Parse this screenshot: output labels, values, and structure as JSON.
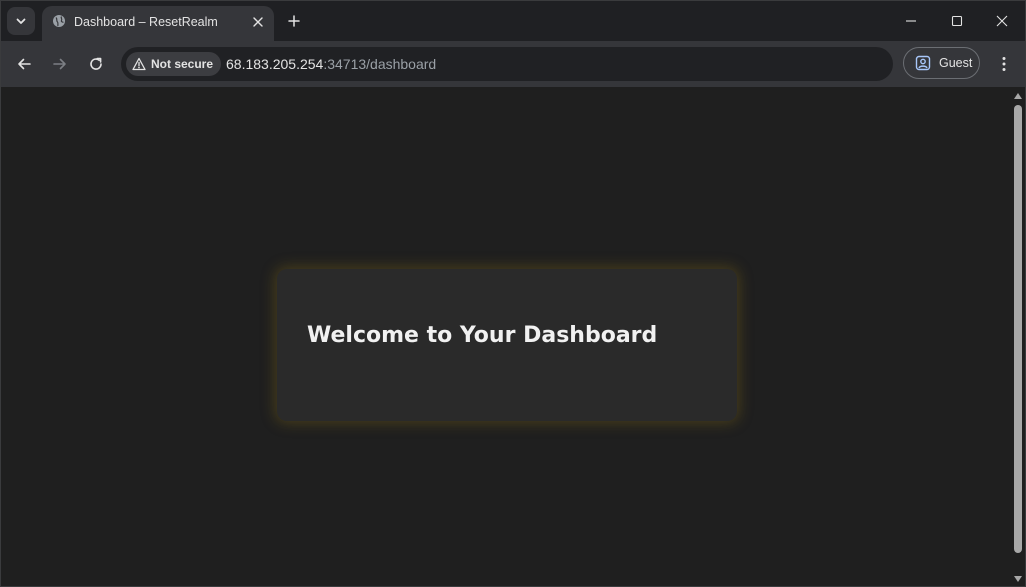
{
  "browser": {
    "tab": {
      "title": "Dashboard – ResetRealm"
    },
    "address_bar": {
      "security_label": "Not secure",
      "url_host": "68.183.205.254",
      "url_rest": ":34713/dashboard"
    },
    "profile": {
      "label": "Guest"
    },
    "icons": {
      "tab_search": "chevron-down-icon",
      "favicon": "globe-icon",
      "tab_close": "close-icon",
      "new_tab": "plus-icon",
      "minimize": "minimize-icon",
      "maximize": "maximize-icon",
      "close_window": "close-icon",
      "back": "arrow-left-icon",
      "forward": "arrow-right-icon",
      "reload": "reload-icon",
      "warning": "warning-triangle-icon",
      "profile": "person-icon",
      "menu": "kebab-menu-icon"
    }
  },
  "page": {
    "card_title": "Welcome to Your Dashboard"
  },
  "colors": {
    "page_background": "#1f1f1f",
    "card_background": "#2a2a2a",
    "card_glow": "#96781a",
    "toolbar": "#35363a"
  }
}
